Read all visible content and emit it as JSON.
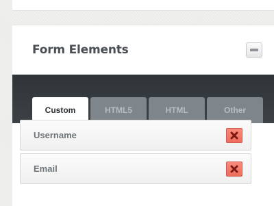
{
  "panel": {
    "title": "Form Elements"
  },
  "tabs": [
    {
      "label": "Custom",
      "active": true
    },
    {
      "label": "HTML5",
      "active": false
    },
    {
      "label": "HTML",
      "active": false
    },
    {
      "label": "Other",
      "active": false
    }
  ],
  "fields": [
    {
      "label": "Username"
    },
    {
      "label": "Email"
    }
  ],
  "icons": {
    "collapse": "minus-icon",
    "delete": "close-icon"
  },
  "colors": {
    "tab_bar": "#353b3f",
    "delete_button": "#f47c6c"
  }
}
